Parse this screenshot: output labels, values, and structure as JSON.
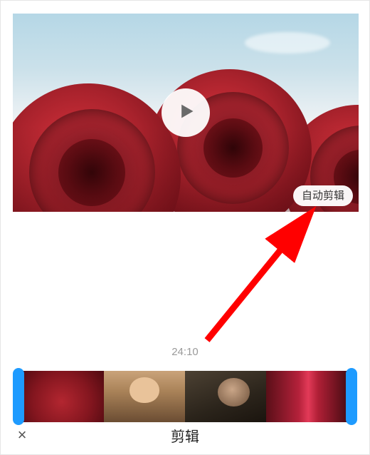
{
  "preview": {
    "auto_edit_label": "自动剪辑",
    "play_icon": "play-icon"
  },
  "timeline": {
    "timecode": "24:10"
  },
  "bottom_bar": {
    "close_glyph": "×",
    "title": "剪辑"
  },
  "annotation": {
    "arrow_color": "#ff0000"
  }
}
